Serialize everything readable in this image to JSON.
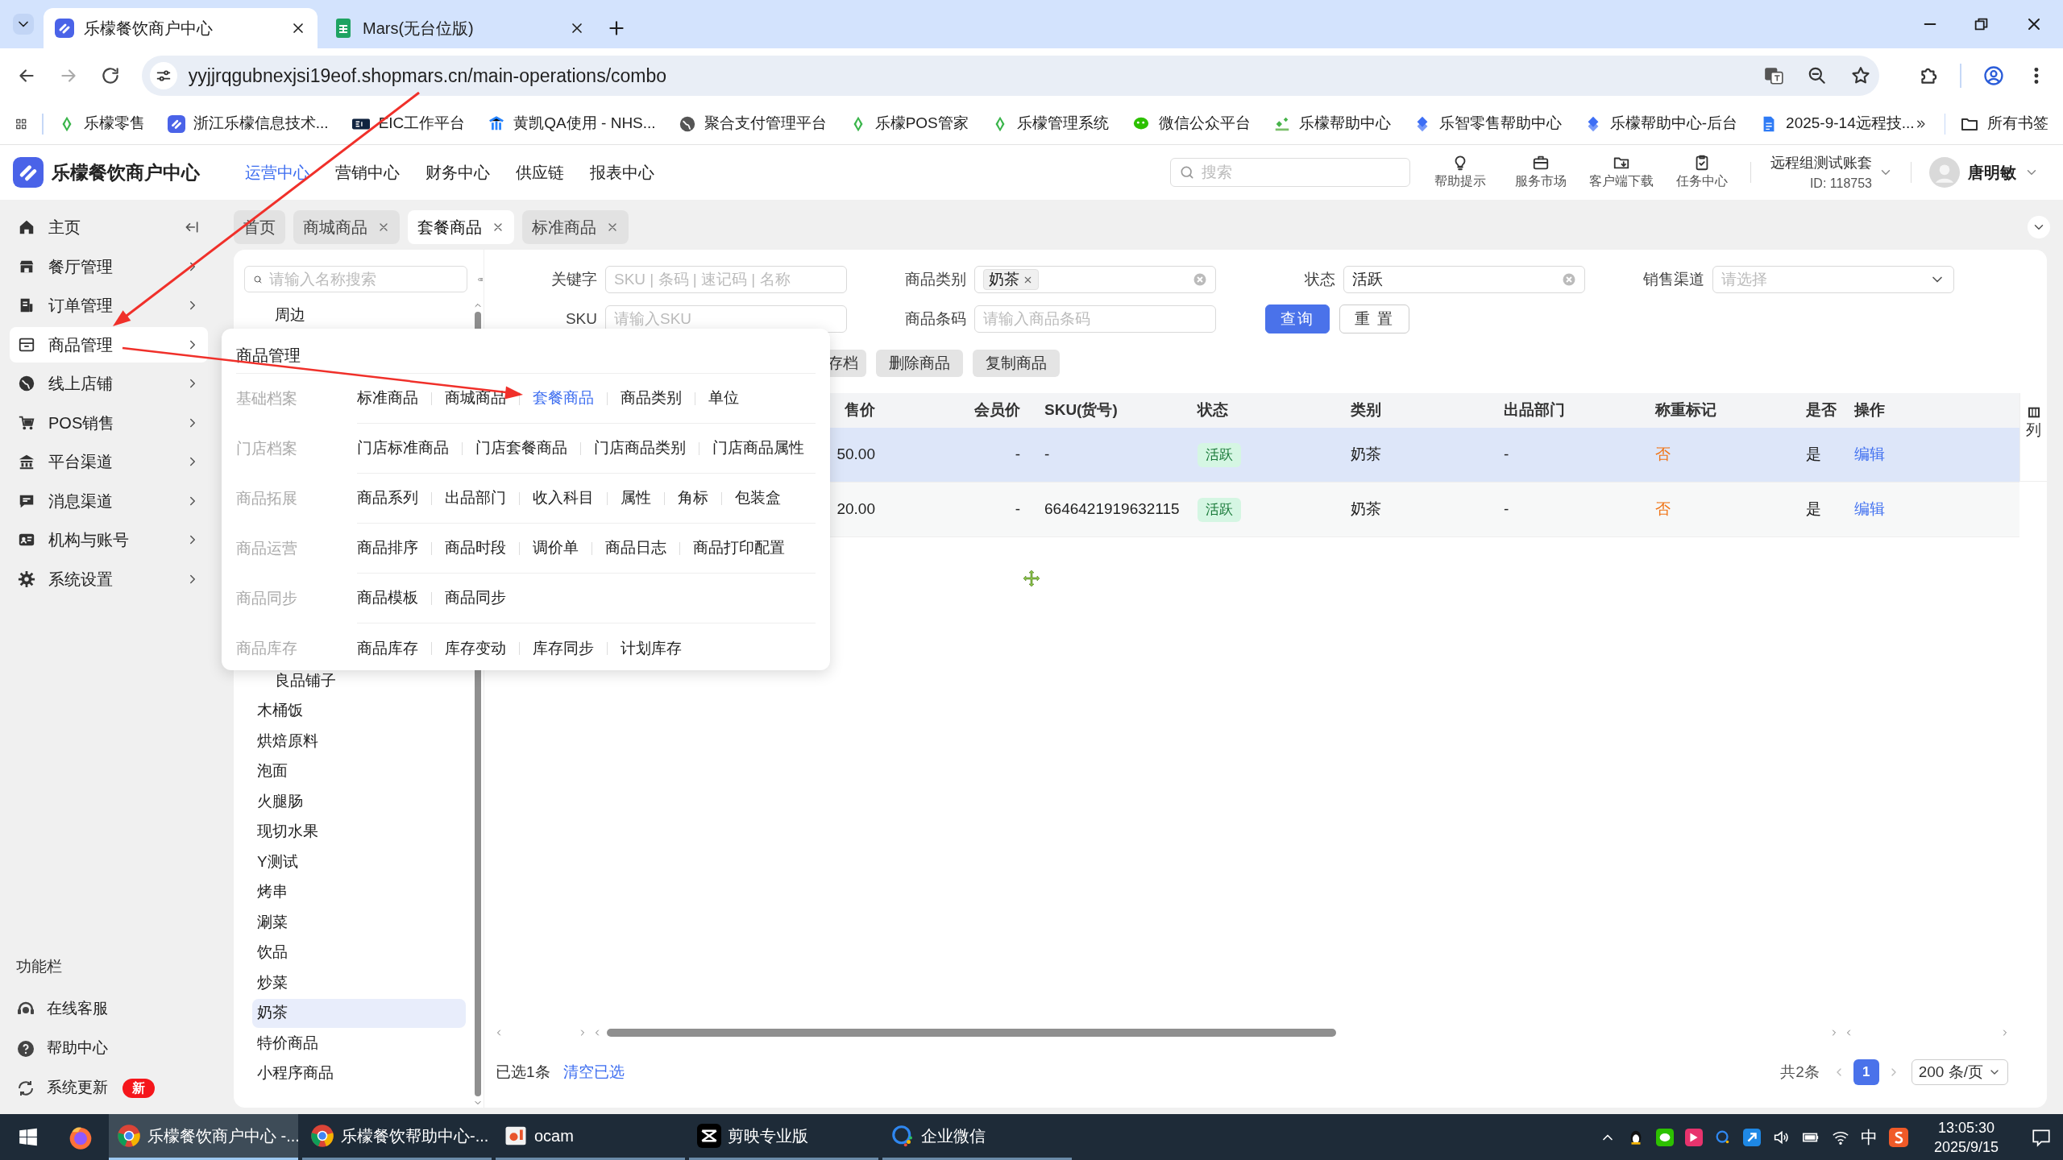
{
  "browser": {
    "tabs": [
      {
        "title": "乐檬餐饮商户中心",
        "selected": true
      },
      {
        "title": "Mars(无台位版)",
        "selected": false
      }
    ],
    "url": "yyjjrqgubnexjsi19eof.shopmars.cn/main-operations/combo",
    "bookmarks": [
      "乐檬零售",
      "浙江乐檬信息技术...",
      "EIC工作平台",
      "黄凯QA使用 - NHS...",
      "聚合支付管理平台",
      "乐檬POS管家",
      "乐檬管理系统",
      "微信公众平台",
      "乐檬帮助中心",
      "乐智零售帮助中心",
      "乐檬帮助中心-后台",
      "2025-9-14远程技..."
    ],
    "all_bookmarks": "所有书签"
  },
  "app": {
    "title": "乐檬餐饮商户中心",
    "nav": [
      {
        "label": "运营中心",
        "selected": true
      },
      {
        "label": "营销中心",
        "selected": false
      },
      {
        "label": "财务中心",
        "selected": false
      },
      {
        "label": "供应链",
        "selected": false
      },
      {
        "label": "报表中心",
        "selected": false
      }
    ],
    "search_placeholder": "搜索",
    "tools": [
      "帮助提示",
      "服务市场",
      "客户端下载",
      "任务中心"
    ],
    "account": {
      "name": "远程组测试账套",
      "id": "ID: 118753"
    },
    "user": "唐明敏"
  },
  "sidebar": {
    "items": [
      {
        "label": "主页",
        "selected": false
      },
      {
        "label": "餐厅管理",
        "selected": false
      },
      {
        "label": "订单管理",
        "selected": false
      },
      {
        "label": "商品管理",
        "selected": true
      },
      {
        "label": "线上店铺",
        "selected": false
      },
      {
        "label": "POS销售",
        "selected": false
      },
      {
        "label": "平台渠道",
        "selected": false
      },
      {
        "label": "消息渠道",
        "selected": false
      },
      {
        "label": "机构与账号",
        "selected": false
      },
      {
        "label": "系统设置",
        "selected": false
      }
    ],
    "section_title": "功能栏",
    "bottom_items": [
      {
        "label": "在线客服"
      },
      {
        "label": "帮助中心"
      },
      {
        "label": "系统更新",
        "badge": "新"
      }
    ]
  },
  "page_tabs": [
    {
      "label": "首页",
      "closable": false,
      "selected": false
    },
    {
      "label": "商城商品",
      "closable": true,
      "selected": false
    },
    {
      "label": "套餐商品",
      "closable": true,
      "selected": true
    },
    {
      "label": "标准商品",
      "closable": true,
      "selected": false
    }
  ],
  "tree": {
    "placeholder": "请输入名称搜索",
    "items": [
      {
        "children": [
          {
            "label": "周边",
            "selected": false
          },
          {
            "label": "良品铺子",
            "selected": false
          }
        ]
      },
      {
        "label": "木桶饭",
        "selected": false
      },
      {
        "label": "烘焙原料",
        "selected": false
      },
      {
        "label": "泡面",
        "selected": false
      },
      {
        "label": "火腿肠",
        "selected": false
      },
      {
        "label": "现切水果",
        "selected": false
      },
      {
        "label": "Y测试",
        "selected": false
      },
      {
        "label": "烤串",
        "selected": false
      },
      {
        "label": "涮菜",
        "selected": false
      },
      {
        "label": "饮品",
        "selected": false
      },
      {
        "label": "炒菜",
        "selected": false
      },
      {
        "label": "奶茶",
        "selected": true
      },
      {
        "label": "特价商品",
        "selected": false
      },
      {
        "label": "小程序商品",
        "selected": false
      }
    ]
  },
  "filters": [
    {
      "label": "关键字",
      "kind": "text",
      "placeholder": "SKU | 条码 | 速记码 | 名称"
    },
    {
      "label": "商品类别",
      "kind": "tags",
      "tags": [
        "奶茶"
      ]
    },
    {
      "label": "状态",
      "kind": "select",
      "value": "活跃"
    },
    {
      "label": "销售渠道",
      "kind": "dropdown",
      "placeholder": "请选择"
    },
    {
      "label": "SKU",
      "kind": "text",
      "placeholder": "请输入SKU"
    },
    {
      "label": "商品条码",
      "kind": "text",
      "placeholder": "请输入商品条码"
    }
  ],
  "buttons": [
    {
      "label": "查询",
      "kind": "primary"
    },
    {
      "label": "重 置",
      "kind": "default"
    }
  ],
  "actions": [
    "存档",
    "删除商品",
    "复制商品"
  ],
  "table": {
    "columns": [
      {
        "label": "售价",
        "kind": "number"
      },
      {
        "label": "会员价",
        "kind": "number"
      },
      {
        "label": "SKU(货号)",
        "kind": "text"
      },
      {
        "label": "状态",
        "kind": "badge"
      },
      {
        "label": "类别",
        "kind": "text"
      },
      {
        "label": "出品部门",
        "kind": "text"
      },
      {
        "label": "称重标记",
        "kind": "flag"
      },
      {
        "label": "是否",
        "kind": "text"
      },
      {
        "label": "操作",
        "kind": "link"
      }
    ],
    "rows": [
      {
        "selected": true,
        "cells": [
          "50.00",
          "-",
          "-",
          "活跃",
          "奶茶",
          "-",
          "否",
          "是",
          "编辑"
        ]
      },
      {
        "selected": false,
        "cells": [
          "20.00",
          "-",
          "6646421919632115",
          "活跃",
          "奶茶",
          "-",
          "否",
          "是",
          "编辑"
        ]
      }
    ],
    "column_settings": "列"
  },
  "footer": {
    "selected_text": "已选1条",
    "clear_link": "清空已选",
    "total": "共2条",
    "page": "1",
    "page_size": "200 条/页"
  },
  "menu": {
    "title": "商品管理",
    "groups": [
      {
        "label": "基础档案",
        "items": [
          {
            "label": "标准商品",
            "selected": false
          },
          {
            "label": "商城商品",
            "selected": false
          },
          {
            "label": "套餐商品",
            "selected": true
          },
          {
            "label": "商品类别",
            "selected": false
          },
          {
            "label": "单位",
            "selected": false
          }
        ]
      },
      {
        "label": "门店档案",
        "items": [
          {
            "label": "门店标准商品",
            "selected": false
          },
          {
            "label": "门店套餐商品",
            "selected": false
          },
          {
            "label": "门店商品类别",
            "selected": false
          },
          {
            "label": "门店商品属性",
            "selected": false
          }
        ]
      },
      {
        "label": "商品拓展",
        "items": [
          {
            "label": "商品系列",
            "selected": false
          },
          {
            "label": "出品部门",
            "selected": false
          },
          {
            "label": "收入科目",
            "selected": false
          },
          {
            "label": "属性",
            "selected": false
          },
          {
            "label": "角标",
            "selected": false
          },
          {
            "label": "包装盒",
            "selected": false
          }
        ]
      },
      {
        "label": "商品运营",
        "items": [
          {
            "label": "商品排序",
            "selected": false
          },
          {
            "label": "商品时段",
            "selected": false
          },
          {
            "label": "调价单",
            "selected": false
          },
          {
            "label": "商品日志",
            "selected": false
          },
          {
            "label": "商品打印配置",
            "selected": false
          }
        ]
      },
      {
        "label": "商品同步",
        "items": [
          {
            "label": "商品模板",
            "selected": false
          },
          {
            "label": "商品同步",
            "selected": false
          }
        ]
      },
      {
        "label": "商品库存",
        "items": [
          {
            "label": "商品库存",
            "selected": false
          },
          {
            "label": "库存变动",
            "selected": false
          },
          {
            "label": "库存同步",
            "selected": false
          },
          {
            "label": "计划库存",
            "selected": false
          }
        ]
      }
    ]
  },
  "taskbar": {
    "items": [
      {
        "label": "乐檬餐饮商户中心 -...",
        "kind": "chrome",
        "selected": true
      },
      {
        "label": "乐檬餐饮帮助中心-...",
        "kind": "chrome",
        "selected": false
      },
      {
        "label": "ocam",
        "kind": "ocam",
        "selected": false
      },
      {
        "label": "剪映专业版",
        "kind": "capcut",
        "selected": false
      },
      {
        "label": "企业微信",
        "kind": "wecom",
        "selected": false
      }
    ],
    "ime": "中",
    "time": "13:05:30",
    "date": "2025/9/15"
  }
}
